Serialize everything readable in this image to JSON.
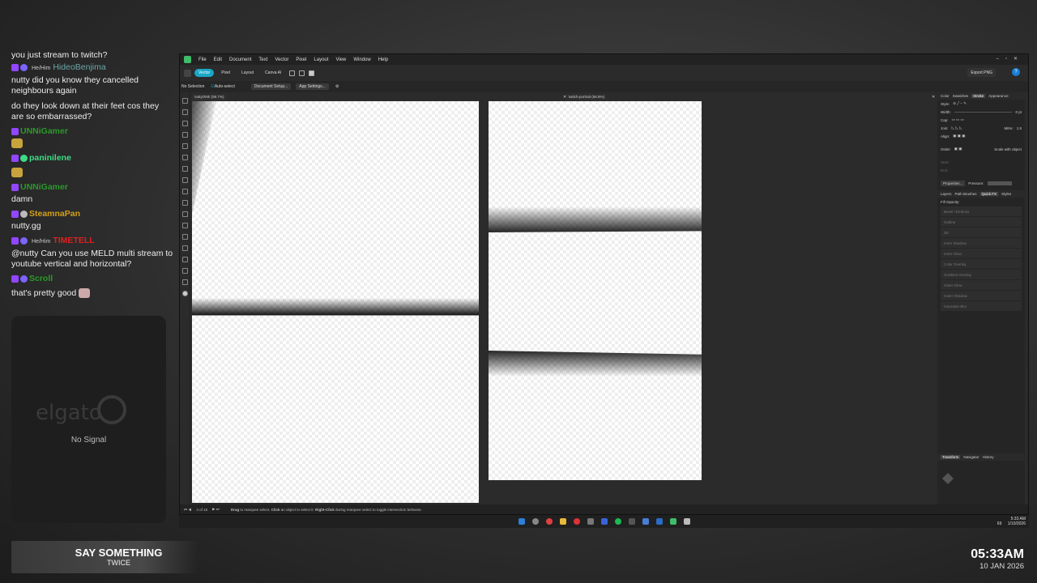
{
  "chat": {
    "messages": [
      {
        "user": "",
        "pronoun": "",
        "text": "you just stream to twitch?",
        "color": "#eeeeee"
      },
      {
        "user": "HideoBenjima",
        "pronoun": "He/Him",
        "text": "",
        "color": "#6ba7a7"
      },
      {
        "user": "",
        "pronoun": "",
        "text": "nutty did you know they cancelled neighbours again",
        "color": "#eeeeee"
      },
      {
        "user": "",
        "pronoun": "",
        "text": "do they look down at their feet cos they are so embarrassed?",
        "color": "#eeeeee"
      },
      {
        "user": "UNNiGamer",
        "pronoun": "",
        "text": "",
        "color": "#2a9a2a"
      },
      {
        "user": "paninilene",
        "pronoun": "",
        "text": "",
        "color": "#3ddc84"
      },
      {
        "user": "UNNiGamer",
        "pronoun": "",
        "text": "",
        "color": "#2a9a2a"
      },
      {
        "user": "",
        "pronoun": "",
        "text": "damn",
        "color": "#eeeeee"
      },
      {
        "user": "SteamnaPan",
        "pronoun": "",
        "text": "",
        "color": "#d4a017"
      },
      {
        "user": "",
        "pronoun": "",
        "text": "nutty.gg",
        "color": "#eeeeee"
      },
      {
        "user": "TIMETELL",
        "pronoun": "He/Him",
        "text": "",
        "color": "#e02020"
      },
      {
        "user": "",
        "pronoun": "",
        "text": "@nutty Can you use MELD multi stream to youtube vertical and horizontal?",
        "color": "#eeeeee"
      },
      {
        "user": "Scroll",
        "pronoun": "",
        "text": "",
        "color": "#2a9a2a"
      },
      {
        "user": "",
        "pronoun": "",
        "text": "that's pretty good",
        "color": "#eeeeee"
      }
    ]
  },
  "capture": {
    "brand": "elgato",
    "status": "No Signal"
  },
  "song": {
    "title": "SAY SOMETHING",
    "artist": "TWICE"
  },
  "clock": {
    "time": "05:33AM",
    "date": "10 JAN 2026"
  },
  "app": {
    "menu": [
      "File",
      "Edit",
      "Document",
      "Text",
      "Vector",
      "Pixel",
      "Layout",
      "View",
      "Window",
      "Help"
    ],
    "personas": [
      "Vector",
      "Pixel",
      "Layout",
      "Canva AI"
    ],
    "export_label": "Export PNG",
    "context": {
      "selection": "No Selection",
      "auto_select": "Auto-select",
      "doc_setup": "Document Setup...",
      "app_settings": "App Settings..."
    },
    "tabs": [
      "nuttyONE (59.7%)",
      "twitch-portrait (56.8%)"
    ],
    "panel_tabs_top": [
      "Color",
      "Swatches",
      "Stroke",
      "Appearance"
    ],
    "stroke_rows": [
      "Style:",
      "Width:",
      "Cap:",
      "Join:",
      "Align:",
      "Order:"
    ],
    "stroke_width_value": "0 pt",
    "mitre_label": "Mitre:",
    "mitre_value": "1.5",
    "scale_label": "Scale with object",
    "start_label": "Start:",
    "end_label": "End:",
    "properties_label": "Properties...",
    "pressure_label": "Pressure:",
    "panel_tabs_mid": [
      "Layers",
      "Path Brushes",
      "Quick FX",
      "Styles"
    ],
    "fill_opacity": "Fill Opacity:",
    "fx_items": [
      "Bevel / Emboss",
      "Outline",
      "3D",
      "Inner Shadow",
      "Inner Glow",
      "Color Overlay",
      "Gradient Overlay",
      "Outer Glow",
      "Outer Shadow",
      "Gaussian Blur"
    ],
    "panel_tabs_bottom": [
      "Transform",
      "Navigator",
      "History"
    ],
    "status": {
      "page": "4 of 15",
      "hint_bold_1": "Drag",
      "hint_1": "to marquee select.",
      "hint_bold_2": "Click",
      "hint_2": "an object to select it.",
      "hint_bold_3": "Right-Click",
      "hint_3": "during marquee select to toggle intersection behavior."
    },
    "tray": {
      "time": "5:33 AM",
      "date": "1/10/2026",
      "num": "69"
    }
  },
  "colors": {
    "accent": "#1aa7c6",
    "affinity": "#3fbd6a"
  }
}
